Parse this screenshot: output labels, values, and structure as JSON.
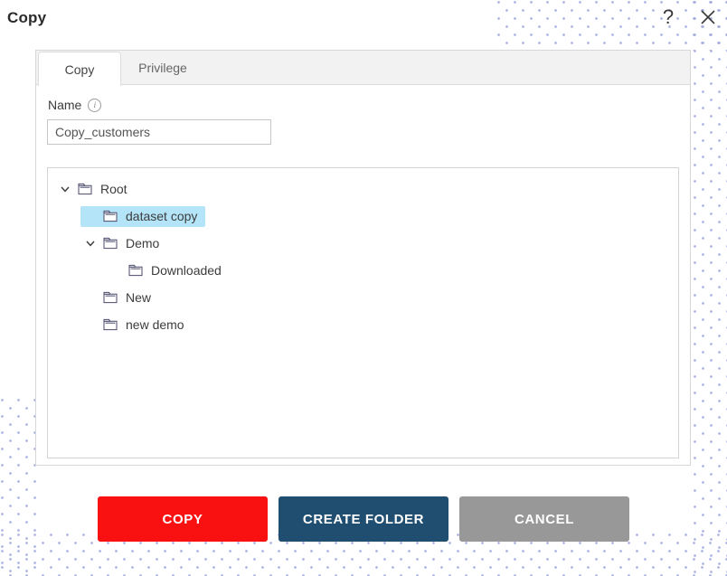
{
  "dialog": {
    "title": "Copy",
    "help_icon": "question-mark-icon",
    "close_icon": "close-icon"
  },
  "tabs": [
    {
      "label": "Copy",
      "active": true
    },
    {
      "label": "Privilege",
      "active": false
    }
  ],
  "form": {
    "name_label": "Name",
    "name_info_icon": "i",
    "name_value": "Copy_customers",
    "name_placeholder": "Name"
  },
  "tree": {
    "nodes": [
      {
        "label": "Root",
        "depth": 0,
        "expanded": true,
        "has_children": true,
        "selected": false
      },
      {
        "label": "dataset copy",
        "depth": 1,
        "expanded": false,
        "has_children": false,
        "selected": true
      },
      {
        "label": "Demo",
        "depth": 1,
        "expanded": true,
        "has_children": true,
        "selected": false
      },
      {
        "label": "Downloaded",
        "depth": 2,
        "expanded": false,
        "has_children": false,
        "selected": false
      },
      {
        "label": "New",
        "depth": 1,
        "expanded": false,
        "has_children": false,
        "selected": false
      },
      {
        "label": "new demo",
        "depth": 1,
        "expanded": false,
        "has_children": false,
        "selected": false
      }
    ]
  },
  "buttons": {
    "copy": "COPY",
    "create_folder": "CREATE FOLDER",
    "cancel": "CANCEL"
  },
  "colors": {
    "copy_red": "#f91010",
    "create_folder_blue": "#1f4e71",
    "cancel_gray": "#989898",
    "selection_blue": "#b4e4f8",
    "tab_strip_gray": "#f2f2f2",
    "pattern_dot": "#9fa8dc"
  }
}
